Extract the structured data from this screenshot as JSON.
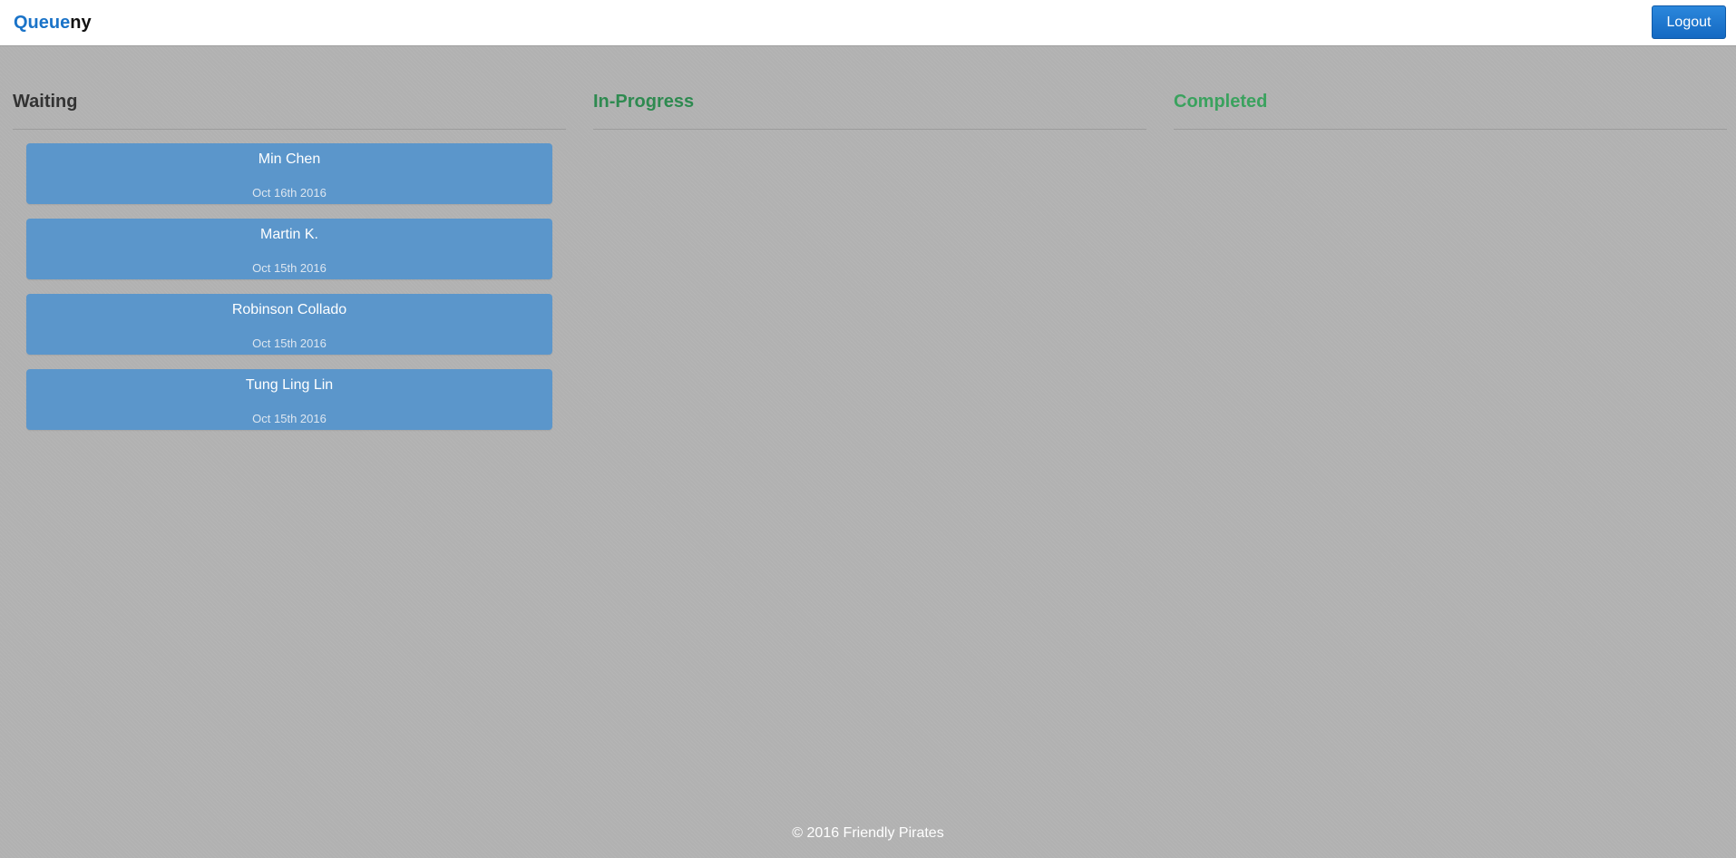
{
  "navbar": {
    "brand_part1": "Queue",
    "brand_part2": "ny",
    "logout_label": "Logout",
    "brand_color": "#1a73c8"
  },
  "columns": {
    "waiting": {
      "title": "Waiting",
      "cards": [
        {
          "name": "Min Chen",
          "date": "Oct 16th 2016"
        },
        {
          "name": "Martin K.",
          "date": "Oct 15th 2016"
        },
        {
          "name": "Robinson Collado",
          "date": "Oct 15th 2016"
        },
        {
          "name": "Tung Ling Lin",
          "date": "Oct 15th 2016"
        }
      ]
    },
    "in_progress": {
      "title": "In-Progress",
      "cards": []
    },
    "completed": {
      "title": "Completed",
      "cards": []
    }
  },
  "footer": {
    "text": "© 2016 Friendly Pirates"
  },
  "colors": {
    "card_bg": "#5b96cb",
    "in_progress_title": "#2e8a50",
    "completed_title": "#3aa25e"
  }
}
